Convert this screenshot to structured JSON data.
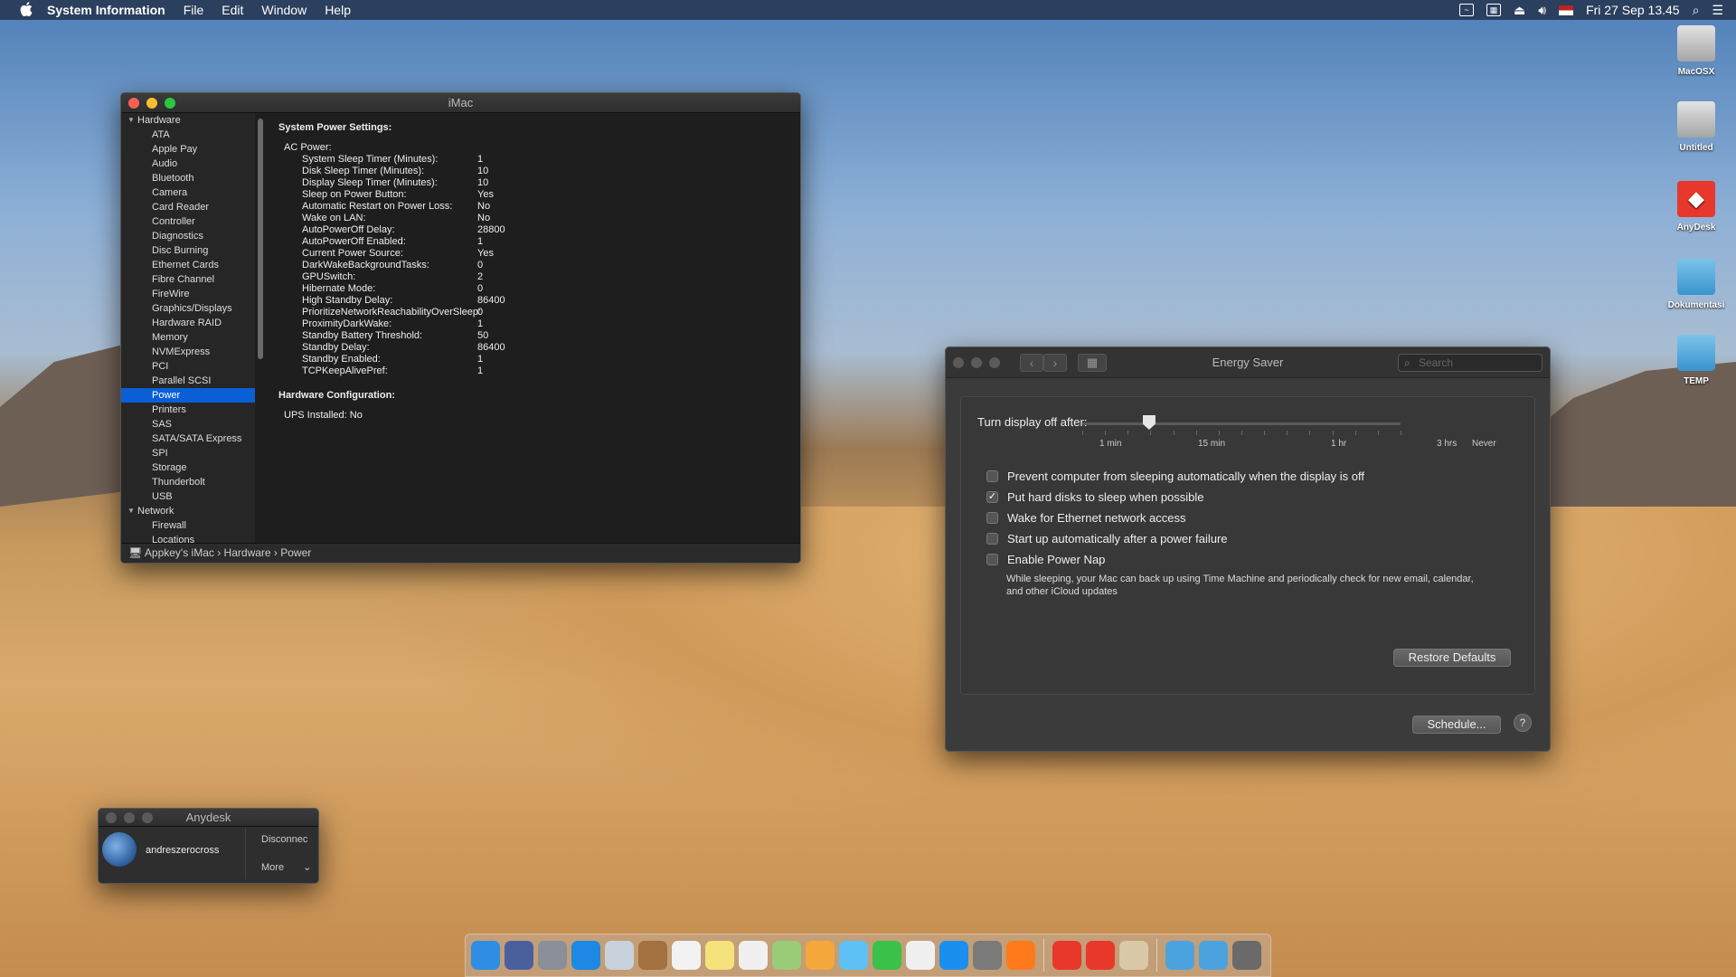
{
  "menubar": {
    "apple": "",
    "app": "System Information",
    "items": [
      "File",
      "Edit",
      "Window",
      "Help"
    ],
    "clock": "Fri 27 Sep  13.45"
  },
  "desktop_icons": [
    "MacOSX",
    "Untitled",
    "AnyDesk",
    "Dokumentasi",
    "TEMP"
  ],
  "sysinfo": {
    "title": "iMac",
    "sidebar": {
      "hardware_label": "Hardware",
      "hardware_items": [
        "ATA",
        "Apple Pay",
        "Audio",
        "Bluetooth",
        "Camera",
        "Card Reader",
        "Controller",
        "Diagnostics",
        "Disc Burning",
        "Ethernet Cards",
        "Fibre Channel",
        "FireWire",
        "Graphics/Displays",
        "Hardware RAID",
        "Memory",
        "NVMExpress",
        "PCI",
        "Parallel SCSI",
        "Power",
        "Printers",
        "SAS",
        "SATA/SATA Express",
        "SPI",
        "Storage",
        "Thunderbolt",
        "USB"
      ],
      "selected": "Power",
      "network_label": "Network",
      "network_items": [
        "Firewall",
        "Locations"
      ]
    },
    "content": {
      "section1": "System Power Settings:",
      "ac_label": "AC Power:",
      "settings": [
        [
          "System Sleep Timer (Minutes):",
          "1"
        ],
        [
          "Disk Sleep Timer (Minutes):",
          "10"
        ],
        [
          "Display Sleep Timer (Minutes):",
          "10"
        ],
        [
          "Sleep on Power Button:",
          "Yes"
        ],
        [
          "Automatic Restart on Power Loss:",
          "No"
        ],
        [
          "Wake on LAN:",
          "No"
        ],
        [
          "AutoPowerOff Delay:",
          "28800"
        ],
        [
          "AutoPowerOff Enabled:",
          "1"
        ],
        [
          "Current Power Source:",
          "Yes"
        ],
        [
          "DarkWakeBackgroundTasks:",
          "0"
        ],
        [
          "GPUSwitch:",
          "2"
        ],
        [
          "Hibernate Mode:",
          "0"
        ],
        [
          "High Standby Delay:",
          "86400"
        ],
        [
          "PrioritizeNetworkReachabilityOverSleep:",
          "0"
        ],
        [
          "ProximityDarkWake:",
          "1"
        ],
        [
          "Standby Battery Threshold:",
          "50"
        ],
        [
          "Standby Delay:",
          "86400"
        ],
        [
          "Standby Enabled:",
          "1"
        ],
        [
          "TCPKeepAlivePref:",
          "1"
        ]
      ],
      "section2": "Hardware Configuration:",
      "ups": "UPS Installed:  No"
    },
    "breadcrumb": "Appkey's iMac › Hardware › Power"
  },
  "energy": {
    "title": "Energy Saver",
    "search_placeholder": "Search",
    "slider_label": "Turn display off after:",
    "slider_value_fraction": 0.21,
    "tick_labels": [
      "1 min",
      "15 min",
      "1 hr",
      "3 hrs",
      "Never"
    ],
    "checkboxes": [
      {
        "label": "Prevent computer from sleeping automatically when the display is off",
        "checked": false
      },
      {
        "label": "Put hard disks to sleep when possible",
        "checked": true
      },
      {
        "label": "Wake for Ethernet network access",
        "checked": false
      },
      {
        "label": "Start up automatically after a power failure",
        "checked": false
      },
      {
        "label": "Enable Power Nap",
        "checked": false
      }
    ],
    "power_nap_desc": "While sleeping, your Mac can back up using Time Machine and periodically check for new email, calendar, and other iCloud updates",
    "restore_label": "Restore Defaults",
    "schedule_label": "Schedule...",
    "help": "?"
  },
  "anydesk": {
    "title": "Anydesk",
    "user": "andreszerocross",
    "disconnect": "Disconnec",
    "more": "More"
  },
  "dock_colors": [
    "#2f8de4",
    "#4a5f9d",
    "#8a8f99",
    "#1e88e5",
    "#c8d2dc",
    "#a3703f",
    "#f2f2f2",
    "#f6e27a",
    "#f0f0f0",
    "#9acb76",
    "#f4a73a",
    "#5ec0f5",
    "#3ac14a",
    "#f0f0f0",
    "#1b8ff0",
    "#7a7a7a",
    "#ff7a1a",
    "#e8372b",
    "#e8372b",
    "#d8c8a8",
    "#4aa3df",
    "#4aa3df",
    "#6a6a6a"
  ]
}
